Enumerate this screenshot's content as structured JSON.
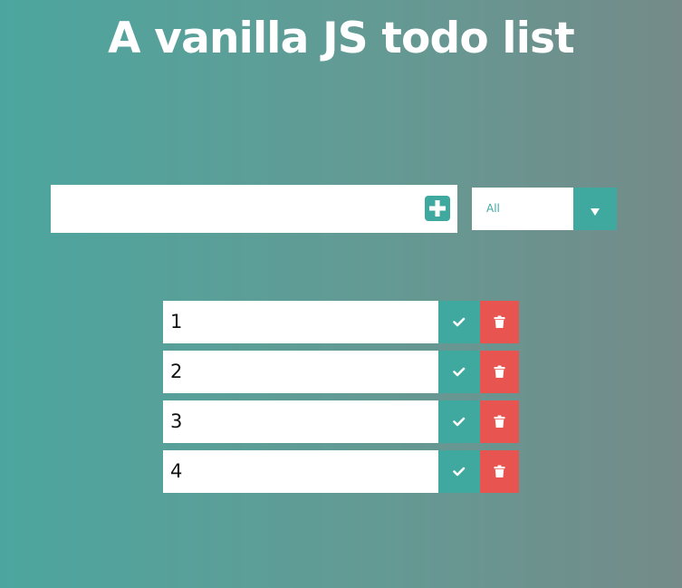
{
  "header": {
    "title": "A vanilla JS todo list"
  },
  "form": {
    "input_value": "",
    "placeholder": "",
    "add_icon": "plus-square-icon"
  },
  "filter": {
    "selected": "All",
    "arrow_icon": "caret-down-icon"
  },
  "todos": [
    {
      "text": "1"
    },
    {
      "text": "2"
    },
    {
      "text": "3"
    },
    {
      "text": "4"
    }
  ],
  "item_actions": {
    "complete_icon": "check-icon",
    "delete_icon": "trash-icon"
  },
  "colors": {
    "accent": "#3fa9a0",
    "danger": "#e85450",
    "background_start": "#4ca69f",
    "background_end": "#748b89"
  }
}
